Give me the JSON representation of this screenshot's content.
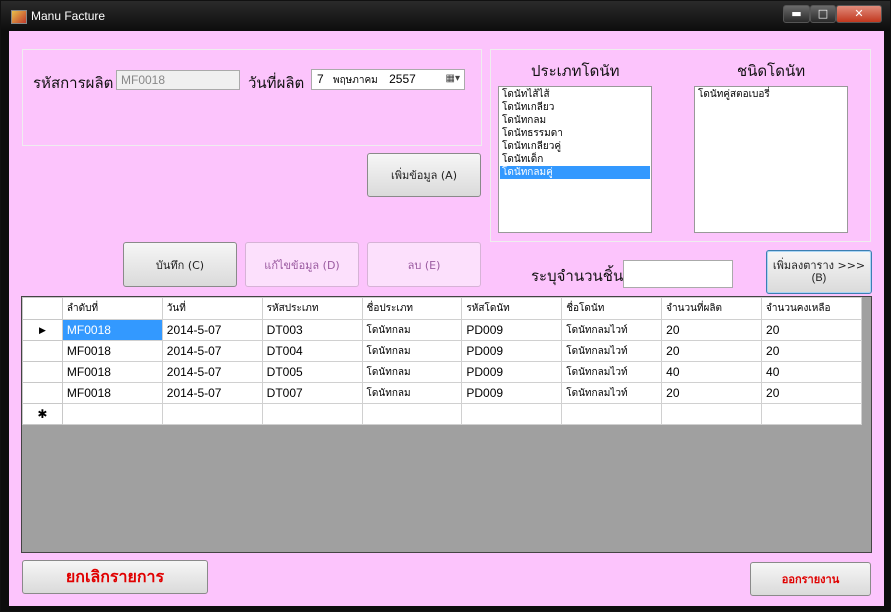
{
  "window": {
    "title": "Manu Facture",
    "min": "▬",
    "max": "□",
    "close": "✕"
  },
  "form": {
    "production_code_label": "รหัสการผลิต",
    "production_code_value": "MF0018",
    "production_date_label": "วันที่ผลิต",
    "date_day": "7",
    "date_month": "พฤษภาคม",
    "date_year": "2557",
    "add_button": "เพิ่มข้อมูล (A)",
    "save_button": "บันทึก (C)",
    "edit_button": "แก้ไขข้อมูล (D)",
    "delete_button": "ลบ (E)",
    "quantity_label": "ระบุจำนวนชิ้น",
    "quantity_value": "",
    "add_table_button_line1": "เพิ่มลงตาราง >>>",
    "add_table_button_line2": "(B)"
  },
  "category": {
    "title": "ประเภทโดนัท",
    "items": [
      "โดนัทไส้ไส้",
      "โดนัทเกลียว",
      "โดนัทกลม",
      "โดนัทธรรมดา",
      "โดนัทเกลียวคู่",
      "โดนัทเด็ก",
      "โดนัทกลมคู่"
    ],
    "selected_index": 6
  },
  "type": {
    "title": "ชนิดโดนัท",
    "items": [
      "โดนัทคู่สตอเบอรี่"
    ]
  },
  "grid": {
    "columns": [
      "ลำดับที่",
      "วันที่",
      "รหัสประเภท",
      "ชื่อประเภท",
      "รหัสโดนัท",
      "ชื่อโดนัท",
      "จำนวนที่ผลิต",
      "จำนวนคงเหลือ"
    ],
    "rows": [
      [
        "MF0018",
        "2014-5-07",
        "DT003",
        "โดนัทกลม",
        "PD009",
        "โดนัทกลมไวท์",
        "20",
        "20"
      ],
      [
        "MF0018",
        "2014-5-07",
        "DT004",
        "โดนัทกลม",
        "PD009",
        "โดนัทกลมไวท์",
        "20",
        "20"
      ],
      [
        "MF0018",
        "2014-5-07",
        "DT005",
        "โดนัทกลม",
        "PD009",
        "โดนัทกลมไวท์",
        "40",
        "40"
      ],
      [
        "MF0018",
        "2014-5-07",
        "DT007",
        "โดนัทกลม",
        "PD009",
        "โดนัทกลมไวท์",
        "20",
        "20"
      ]
    ],
    "current_row_marker": "▶",
    "new_row_marker": "✱"
  },
  "footer": {
    "cancel_button": "ยกเลิกรายการ",
    "report_button": "ออกรายงาน"
  },
  "colors": {
    "background": "#fcc4fc",
    "accent_red": "#e00000",
    "selection": "#3399ff"
  }
}
